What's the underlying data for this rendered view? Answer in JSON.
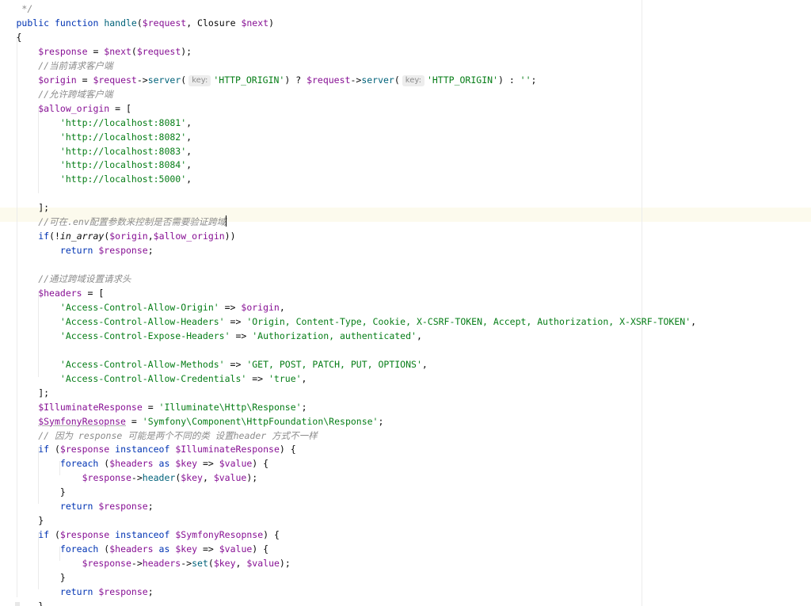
{
  "editor": {
    "lines": [
      [
        {
          "t": " */",
          "c": "cmt"
        }
      ],
      [
        {
          "t": "public",
          "c": "kw"
        },
        {
          "t": " "
        },
        {
          "t": "function",
          "c": "kw"
        },
        {
          "t": " "
        },
        {
          "t": "handle",
          "c": "fn"
        },
        {
          "t": "("
        },
        {
          "t": "$request",
          "c": "var"
        },
        {
          "t": ", Closure "
        },
        {
          "t": "$next",
          "c": "var"
        },
        {
          "t": ")"
        }
      ],
      [
        {
          "t": "{"
        }
      ],
      [
        {
          "t": "    "
        },
        {
          "t": "$response",
          "c": "var"
        },
        {
          "t": " = "
        },
        {
          "t": "$next",
          "c": "var"
        },
        {
          "t": "("
        },
        {
          "t": "$request",
          "c": "var"
        },
        {
          "t": ");"
        }
      ],
      [
        {
          "t": "    "
        },
        {
          "t": "//当前请求客户端",
          "c": "cmt"
        }
      ],
      [
        {
          "t": "    "
        },
        {
          "t": "$origin",
          "c": "var"
        },
        {
          "t": " = "
        },
        {
          "t": "$request",
          "c": "var"
        },
        {
          "t": "->"
        },
        {
          "t": "server",
          "c": "fn"
        },
        {
          "t": "("
        },
        {
          "t": "key:",
          "c": "hint"
        },
        {
          "t": "'HTTP_ORIGIN'",
          "c": "str"
        },
        {
          "t": ") ? "
        },
        {
          "t": "$request",
          "c": "var"
        },
        {
          "t": "->"
        },
        {
          "t": "server",
          "c": "fn"
        },
        {
          "t": "("
        },
        {
          "t": "key:",
          "c": "hint"
        },
        {
          "t": "'HTTP_ORIGIN'",
          "c": "str"
        },
        {
          "t": ") : "
        },
        {
          "t": "''",
          "c": "str"
        },
        {
          "t": ";"
        }
      ],
      [
        {
          "t": "    "
        },
        {
          "t": "//允许跨域客户端",
          "c": "cmt"
        }
      ],
      [
        {
          "t": "    "
        },
        {
          "t": "$allow_origin",
          "c": "var"
        },
        {
          "t": " = ["
        }
      ],
      [
        {
          "t": "        "
        },
        {
          "t": "'http://localhost:8081'",
          "c": "str"
        },
        {
          "t": ","
        }
      ],
      [
        {
          "t": "        "
        },
        {
          "t": "'http://localhost:8082'",
          "c": "str"
        },
        {
          "t": ","
        }
      ],
      [
        {
          "t": "        "
        },
        {
          "t": "'http://localhost:8083'",
          "c": "str"
        },
        {
          "t": ","
        }
      ],
      [
        {
          "t": "        "
        },
        {
          "t": "'http://localhost:8084'",
          "c": "str"
        },
        {
          "t": ","
        }
      ],
      [
        {
          "t": "        "
        },
        {
          "t": "'http://localhost:5000'",
          "c": "str"
        },
        {
          "t": ","
        }
      ],
      [],
      [
        {
          "t": "    "
        },
        {
          "t": "];"
        }
      ],
      [
        {
          "t": "    "
        },
        {
          "t": "//可在.env配置参数来控制是否需要验证跨域",
          "c": "cmt"
        },
        {
          "t": "",
          "c": "caret"
        }
      ],
      [
        {
          "t": "    "
        },
        {
          "t": "if",
          "c": "kw"
        },
        {
          "t": "(!"
        },
        {
          "t": "in_array",
          "c": "it"
        },
        {
          "t": "("
        },
        {
          "t": "$origin",
          "c": "var"
        },
        {
          "t": ","
        },
        {
          "t": "$allow_origin",
          "c": "var"
        },
        {
          "t": "))"
        }
      ],
      [
        {
          "t": "        "
        },
        {
          "t": "return",
          "c": "kw"
        },
        {
          "t": " "
        },
        {
          "t": "$response",
          "c": "var"
        },
        {
          "t": ";"
        }
      ],
      [],
      [
        {
          "t": "    "
        },
        {
          "t": "//通过跨域设置请求头",
          "c": "cmt"
        }
      ],
      [
        {
          "t": "    "
        },
        {
          "t": "$headers",
          "c": "var"
        },
        {
          "t": " = ["
        }
      ],
      [
        {
          "t": "        "
        },
        {
          "t": "'Access-Control-Allow-Origin'",
          "c": "str"
        },
        {
          "t": " => "
        },
        {
          "t": "$origin",
          "c": "var"
        },
        {
          "t": ","
        }
      ],
      [
        {
          "t": "        "
        },
        {
          "t": "'Access-Control-Allow-Headers'",
          "c": "str"
        },
        {
          "t": " => "
        },
        {
          "t": "'Origin, Content-Type, Cookie, X-CSRF-TOKEN, Accept, Authorization, X-XSRF-TOKEN'",
          "c": "str"
        },
        {
          "t": ","
        }
      ],
      [
        {
          "t": "        "
        },
        {
          "t": "'Access-Control-Expose-Headers'",
          "c": "str"
        },
        {
          "t": " => "
        },
        {
          "t": "'Authorization, authenticated'",
          "c": "str"
        },
        {
          "t": ","
        }
      ],
      [],
      [
        {
          "t": "        "
        },
        {
          "t": "'Access-Control-Allow-Methods'",
          "c": "str"
        },
        {
          "t": " => "
        },
        {
          "t": "'GET, POST, PATCH, PUT, OPTIONS'",
          "c": "str"
        },
        {
          "t": ","
        }
      ],
      [
        {
          "t": "        "
        },
        {
          "t": "'Access-Control-Allow-Credentials'",
          "c": "str"
        },
        {
          "t": " => "
        },
        {
          "t": "'true'",
          "c": "str"
        },
        {
          "t": ","
        }
      ],
      [
        {
          "t": "    "
        },
        {
          "t": "];"
        }
      ],
      [
        {
          "t": "    "
        },
        {
          "t": "$IlluminateResponse",
          "c": "var"
        },
        {
          "t": " = "
        },
        {
          "t": "'Illuminate\\Http\\Response'",
          "c": "str"
        },
        {
          "t": ";"
        }
      ],
      [
        {
          "t": "    "
        },
        {
          "t": "$SymfonyResopnse",
          "c": "var und"
        },
        {
          "t": " = "
        },
        {
          "t": "'Symfony\\Component\\HttpFoundation\\Response'",
          "c": "str"
        },
        {
          "t": ";"
        }
      ],
      [
        {
          "t": "    "
        },
        {
          "t": "// 因为 response 可能是两个不同的类 设置header 方式不一样",
          "c": "cmt"
        }
      ],
      [
        {
          "t": "    "
        },
        {
          "t": "if",
          "c": "kw"
        },
        {
          "t": " ("
        },
        {
          "t": "$response",
          "c": "var"
        },
        {
          "t": " "
        },
        {
          "t": "instanceof",
          "c": "kw"
        },
        {
          "t": " "
        },
        {
          "t": "$IlluminateResponse",
          "c": "var"
        },
        {
          "t": ") {"
        }
      ],
      [
        {
          "t": "        "
        },
        {
          "t": "foreach",
          "c": "kw"
        },
        {
          "t": " ("
        },
        {
          "t": "$headers",
          "c": "var"
        },
        {
          "t": " "
        },
        {
          "t": "as",
          "c": "kw"
        },
        {
          "t": " "
        },
        {
          "t": "$key",
          "c": "var"
        },
        {
          "t": " => "
        },
        {
          "t": "$value",
          "c": "var"
        },
        {
          "t": ") {"
        }
      ],
      [
        {
          "t": "            "
        },
        {
          "t": "$response",
          "c": "var"
        },
        {
          "t": "->"
        },
        {
          "t": "header",
          "c": "fn"
        },
        {
          "t": "("
        },
        {
          "t": "$key",
          "c": "var"
        },
        {
          "t": ", "
        },
        {
          "t": "$value",
          "c": "var"
        },
        {
          "t": ");"
        }
      ],
      [
        {
          "t": "        "
        },
        {
          "t": "}"
        }
      ],
      [
        {
          "t": "        "
        },
        {
          "t": "return",
          "c": "kw"
        },
        {
          "t": " "
        },
        {
          "t": "$response",
          "c": "var"
        },
        {
          "t": ";"
        }
      ],
      [
        {
          "t": "    "
        },
        {
          "t": "}"
        }
      ],
      [
        {
          "t": "    "
        },
        {
          "t": "if",
          "c": "kw"
        },
        {
          "t": " ("
        },
        {
          "t": "$response",
          "c": "var"
        },
        {
          "t": " "
        },
        {
          "t": "instanceof",
          "c": "kw"
        },
        {
          "t": " "
        },
        {
          "t": "$SymfonyResopnse",
          "c": "var"
        },
        {
          "t": ") {"
        }
      ],
      [
        {
          "t": "        "
        },
        {
          "t": "foreach",
          "c": "kw"
        },
        {
          "t": " ("
        },
        {
          "t": "$headers",
          "c": "var"
        },
        {
          "t": " "
        },
        {
          "t": "as",
          "c": "kw"
        },
        {
          "t": " "
        },
        {
          "t": "$key",
          "c": "var"
        },
        {
          "t": " => "
        },
        {
          "t": "$value",
          "c": "var"
        },
        {
          "t": ") {"
        }
      ],
      [
        {
          "t": "            "
        },
        {
          "t": "$response",
          "c": "var"
        },
        {
          "t": "->"
        },
        {
          "t": "headers",
          "c": "var"
        },
        {
          "t": "->"
        },
        {
          "t": "set",
          "c": "fn"
        },
        {
          "t": "("
        },
        {
          "t": "$key",
          "c": "var"
        },
        {
          "t": ", "
        },
        {
          "t": "$value",
          "c": "var"
        },
        {
          "t": ");"
        }
      ],
      [
        {
          "t": "        "
        },
        {
          "t": "}"
        }
      ],
      [
        {
          "t": "        "
        },
        {
          "t": "return",
          "c": "kw"
        },
        {
          "t": " "
        },
        {
          "t": "$response",
          "c": "var"
        },
        {
          "t": ";"
        }
      ],
      [
        {
          "t": "    "
        },
        {
          "t": "}"
        }
      ]
    ]
  }
}
